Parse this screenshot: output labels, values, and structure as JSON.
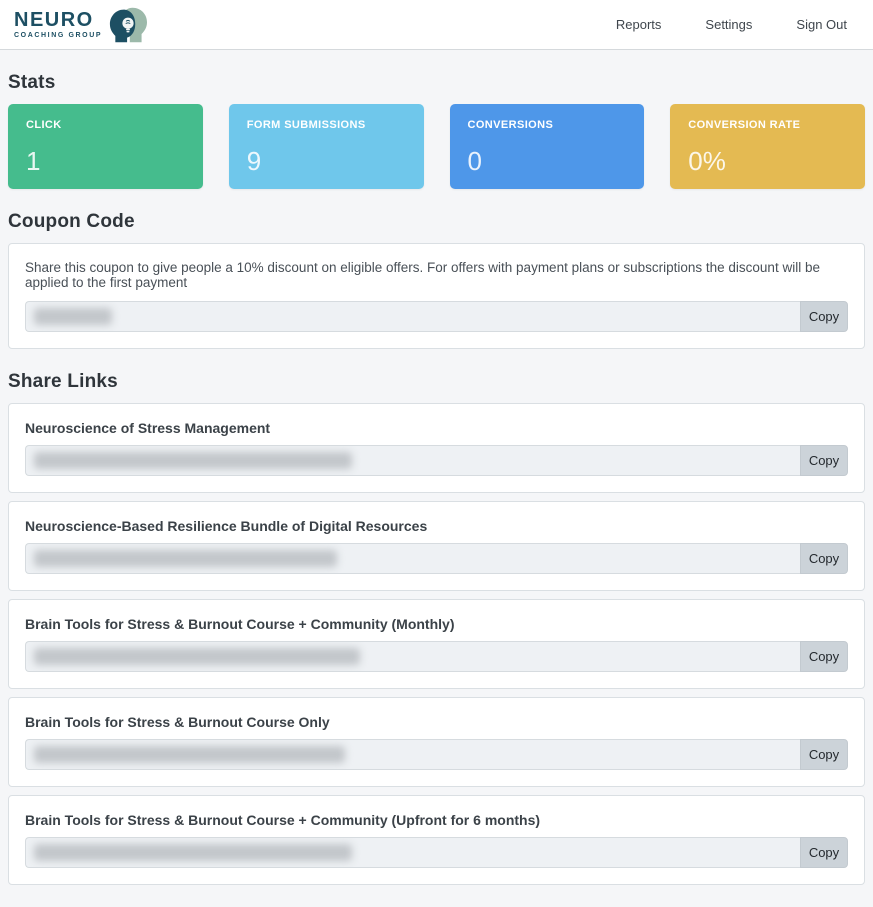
{
  "brand": {
    "name_top": "NEURO",
    "name_bottom": "COACHING GROUP"
  },
  "nav": {
    "reports": "Reports",
    "settings": "Settings",
    "sign_out": "Sign Out"
  },
  "stats": {
    "heading": "Stats",
    "cards": [
      {
        "label": "CLICK",
        "value": "1",
        "color": "#45bc8d"
      },
      {
        "label": "FORM SUBMISSIONS",
        "value": "9",
        "color": "#6fc7eb"
      },
      {
        "label": "CONVERSIONS",
        "value": "0",
        "color": "#4e97e9"
      },
      {
        "label": "CONVERSION RATE",
        "value": "0%",
        "color": "#e4ba52"
      }
    ]
  },
  "coupon": {
    "heading": "Coupon Code",
    "description": "Share this coupon to give people a 10% discount on eligible offers. For offers with payment plans or subscriptions the discount will be applied to the first payment",
    "copy_label": "Copy"
  },
  "share_links": {
    "heading": "Share Links",
    "copy_label": "Copy",
    "items": [
      {
        "title": "Neuroscience of Stress Management"
      },
      {
        "title": "Neuroscience-Based Resilience Bundle of Digital Resources"
      },
      {
        "title": "Brain Tools for Stress & Burnout Course + Community (Monthly)"
      },
      {
        "title": "Brain Tools for Stress & Burnout Course Only"
      },
      {
        "title": "Brain Tools for Stress & Burnout Course + Community (Upfront for 6 months)"
      }
    ]
  }
}
